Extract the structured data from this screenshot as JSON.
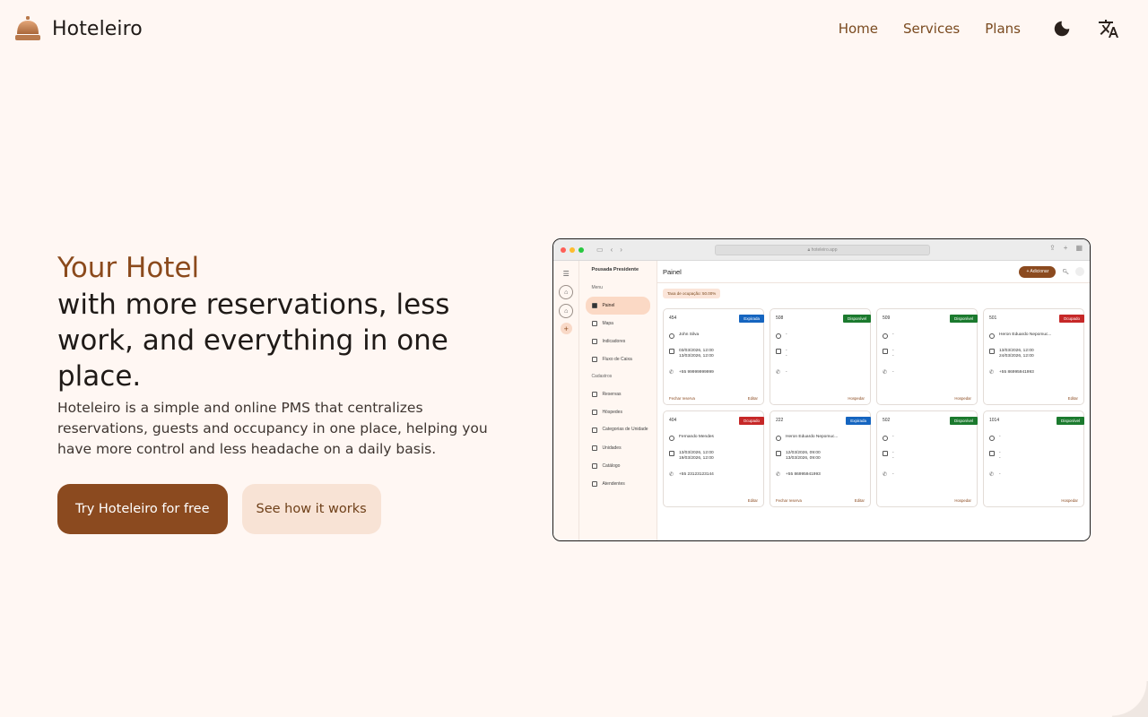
{
  "header": {
    "brand_name": "Hoteleiro",
    "nav": [
      {
        "label": "Home"
      },
      {
        "label": "Services"
      },
      {
        "label": "Plans"
      }
    ],
    "icons": {
      "theme": "moon-icon",
      "language": "translate-icon"
    }
  },
  "hero": {
    "accent": "Your Hotel",
    "title": "with more reservations, less work, and everything in one place.",
    "description": "Hoteleiro is a simple and online PMS that centralizes reservations, guests and occupancy in one place, helping you have more control and less headache on a daily basis.",
    "primary_cta": "Try Hoteleiro for free",
    "secondary_cta": "See how it works"
  },
  "colors": {
    "background": "#fff7f3",
    "accent": "#8b4a1f",
    "secondary_bg": "#f8e3d5",
    "badge_expirada": "#1565c0",
    "badge_disponivel": "#1b7a2e",
    "badge_ocupado": "#c62828"
  },
  "mock": {
    "url": "hoteleiro.app",
    "property": "Pousada Presidente",
    "sidebar": {
      "section_menu": "Menu",
      "menu_items": [
        "Painel",
        "Mapa",
        "Indicadores",
        "Fluxo de Caixa"
      ],
      "section_cadastros": "Cadastros",
      "cadastro_items": [
        "Reservas",
        "Hóspedes",
        "Categorias de Unidade",
        "Unidades",
        "Catálogo",
        "Atendentes"
      ]
    },
    "page_title": "Painel",
    "add_label": "+ Adicionar",
    "occupancy": "Taxa de ocupação: 50.00%",
    "cards": [
      {
        "num": "454",
        "status": "Expirada",
        "type": "exp",
        "guest": "John Silva",
        "dates": "03/03/2026, 12:00\n13/03/2026, 12:00",
        "phone": "+55 99999999999",
        "left": "Fechar reserva",
        "right": "Editar"
      },
      {
        "num": "508",
        "status": "Disponível",
        "type": "disp",
        "guest": "-",
        "dates": "-\n-",
        "phone": "-",
        "left": "",
        "right": "Hospedar"
      },
      {
        "num": "509",
        "status": "Disponível",
        "type": "disp",
        "guest": "-",
        "dates": "-\n-",
        "phone": "-",
        "left": "",
        "right": "Hospedar"
      },
      {
        "num": "501",
        "status": "Ocupado",
        "type": "ocup",
        "guest": "Heron Eduardo Nepomuc...",
        "dates": "13/03/2026, 12:00\n24/03/2026, 12:00",
        "phone": "+55 86995941993",
        "left": "",
        "right": "Editar"
      },
      {
        "num": "404",
        "status": "Ocupado",
        "type": "ocup",
        "guest": "Fernando Mendes",
        "dates": "13/03/2026, 12:00\n19/03/2026, 12:00",
        "phone": "+55 23123123144",
        "left": "",
        "right": "Editar"
      },
      {
        "num": "222",
        "status": "Expirada",
        "type": "exp",
        "guest": "Heron Eduardo Nepomuc...",
        "dates": "12/03/2026, 09:00\n13/03/2026, 09:00",
        "phone": "+55 86995941993",
        "left": "Fechar reserva",
        "right": "Editar"
      },
      {
        "num": "502",
        "status": "Disponível",
        "type": "disp",
        "guest": "-",
        "dates": "-\n-",
        "phone": "-",
        "left": "",
        "right": "Hospedar"
      },
      {
        "num": "1014",
        "status": "Disponível",
        "type": "disp",
        "guest": "-",
        "dates": "-\n-",
        "phone": "-",
        "left": "",
        "right": "Hospedar"
      }
    ]
  }
}
